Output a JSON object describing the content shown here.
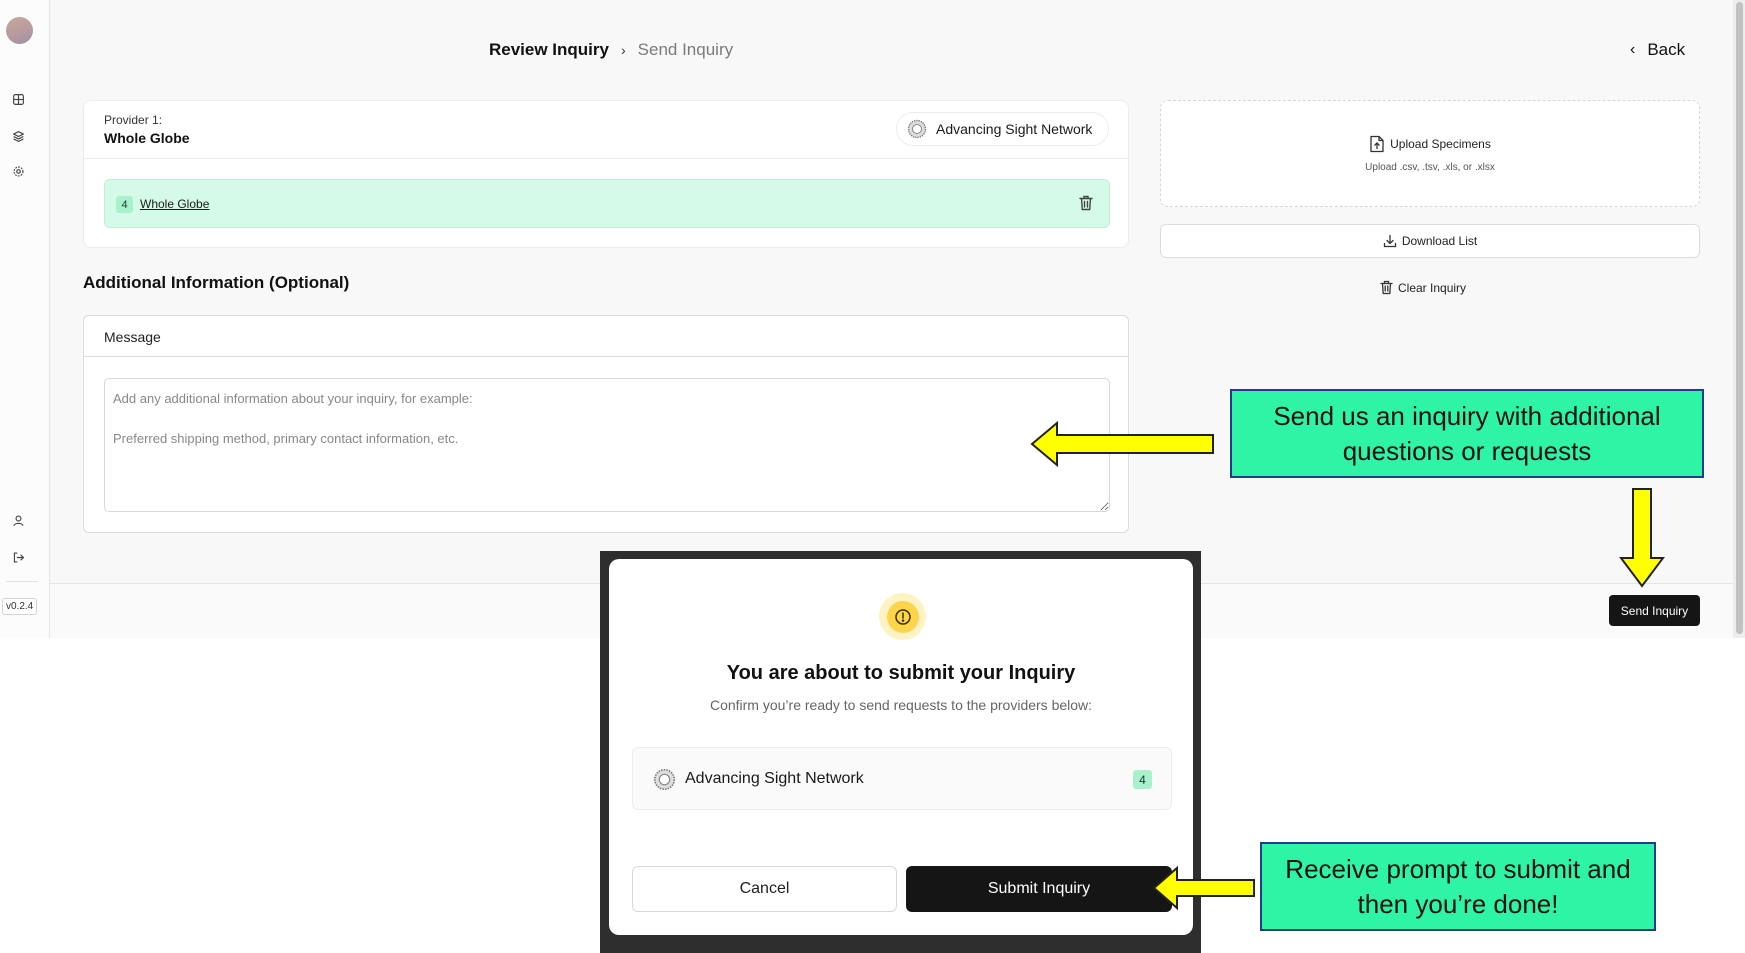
{
  "app": {
    "version": "v0.2.4",
    "breadcrumb": {
      "current": "Review Inquiry",
      "next": "Send Inquiry"
    },
    "back_label": "Back"
  },
  "provider": {
    "label": "Provider 1:",
    "name": "Whole Globe",
    "network": "Advancing Sight Network",
    "items": [
      {
        "count": "4",
        "name": "Whole Globe"
      }
    ]
  },
  "additional": {
    "title": "Additional Information (Optional)",
    "message_label": "Message",
    "message_placeholder": "Add any additional information about your inquiry, for example:\n\nPreferred shipping method, primary contact information, etc."
  },
  "side_panel": {
    "upload_title": "Upload Specimens",
    "upload_sub": "Upload .csv, .tsv, .xls, or .xlsx",
    "download_label": "Download List",
    "clear_label": "Clear Inquiry"
  },
  "footer": {
    "send_label": "Send Inquiry"
  },
  "modal": {
    "title": "You are about to submit your Inquiry",
    "subtitle": "Confirm you’re ready to send requests to the providers below:",
    "provider_name": "Advancing Sight Network",
    "provider_count": "4",
    "cancel_label": "Cancel",
    "submit_label": "Submit Inquiry"
  },
  "callouts": {
    "top": "Send us an inquiry with additional questions or requests",
    "bottom": "Receive prompt to submit and then you’re done!"
  },
  "colors": {
    "callout_bg": "#2ef5a6",
    "callout_border": "#1d3e8a",
    "arrow_fill": "#ffff00",
    "item_row_bg": "#d4fbe8",
    "primary_button": "#151515",
    "warning": "#fcd54a"
  },
  "icons": {
    "sidebar": [
      "grid-icon",
      "layers-icon",
      "settings-icon",
      "user-icon",
      "logout-icon"
    ],
    "upload": "file-upload-icon",
    "download": "download-icon",
    "clear": "trash-icon",
    "warning": "alert-circle-icon"
  }
}
